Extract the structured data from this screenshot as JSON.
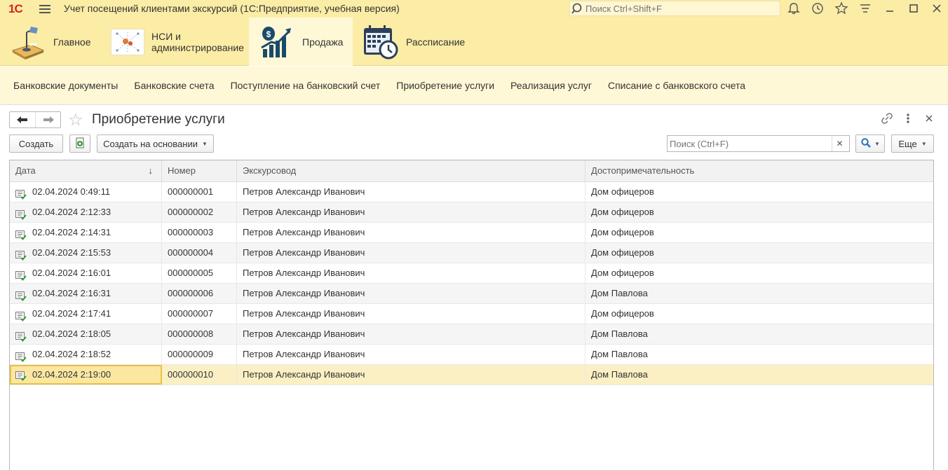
{
  "titlebar": {
    "logo": "1С",
    "title": "Учет посещений клиентами экскурсий  (1С:Предприятие, учебная версия)",
    "search_placeholder": "Поиск Ctrl+Shift+F"
  },
  "sections": [
    {
      "label": "Главное",
      "icon": "home-desk-icon"
    },
    {
      "label": "НСИ и\nадминистрирование",
      "icon": "settings-network-icon"
    },
    {
      "label": "Продажа",
      "icon": "sales-growth-icon",
      "active": true
    },
    {
      "label": "Рассписание",
      "icon": "calendar-clock-icon"
    }
  ],
  "nav": [
    "Банковские документы",
    "Банковские счета",
    "Поступление на банковский счет",
    "Приобретение услуги",
    "Реализация услуг",
    "Списание с банковского счета"
  ],
  "form": {
    "title": "Приобретение услуги",
    "create_label": "Создать",
    "create_based_label": "Создать на основании",
    "search_placeholder": "Поиск (Ctrl+F)",
    "more_label": "Еще"
  },
  "table": {
    "columns": [
      "Дата",
      "Номер",
      "Экскурсовод",
      "Достопримечательность"
    ],
    "sort_indicator": "↓",
    "rows": [
      {
        "date": "02.04.2024 0:49:11",
        "number": "000000001",
        "guide": "Петров Александр Иванович",
        "sight": "Дом офицеров"
      },
      {
        "date": "02.04.2024 2:12:33",
        "number": "000000002",
        "guide": "Петров Александр Иванович",
        "sight": "Дом офицеров"
      },
      {
        "date": "02.04.2024 2:14:31",
        "number": "000000003",
        "guide": "Петров Александр Иванович",
        "sight": "Дом офицеров"
      },
      {
        "date": "02.04.2024 2:15:53",
        "number": "000000004",
        "guide": "Петров Александр Иванович",
        "sight": "Дом офицеров"
      },
      {
        "date": "02.04.2024 2:16:01",
        "number": "000000005",
        "guide": "Петров Александр Иванович",
        "sight": "Дом офицеров"
      },
      {
        "date": "02.04.2024 2:16:31",
        "number": "000000006",
        "guide": "Петров Александр Иванович",
        "sight": "Дом Павлова"
      },
      {
        "date": "02.04.2024 2:17:41",
        "number": "000000007",
        "guide": "Петров Александр Иванович",
        "sight": "Дом офицеров"
      },
      {
        "date": "02.04.2024 2:18:05",
        "number": "000000008",
        "guide": "Петров Александр Иванович",
        "sight": "Дом Павлова"
      },
      {
        "date": "02.04.2024 2:18:52",
        "number": "000000009",
        "guide": "Петров Александр Иванович",
        "sight": "Дом Павлова"
      },
      {
        "date": "02.04.2024 2:19:00",
        "number": "000000010",
        "guide": "Петров Александр Иванович",
        "sight": "Дом Павлова",
        "selected": true
      }
    ]
  },
  "colors": {
    "accent_bar": "#fbeca6",
    "nav_bg": "#fff8d6",
    "selection": "#fbf0c4",
    "logo_red": "#d4261f"
  }
}
